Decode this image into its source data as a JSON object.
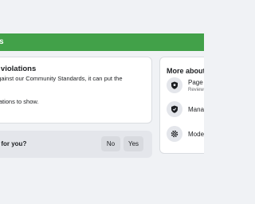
{
  "status_bar": {
    "color": "#42a149"
  },
  "violations": {
    "title": "s violations",
    "description": "against our Community Standards, it can put the",
    "description_line2": "s.",
    "empty_text": "olations to show."
  },
  "feedback": {
    "question": "ul for you?",
    "no_label": "No",
    "yes_label": "Yes"
  },
  "more_about": {
    "title": "More about",
    "items": [
      {
        "label": "Page r",
        "sublabel": "Review",
        "icon": "shield-icon"
      },
      {
        "label": "Manag",
        "sublabel": "",
        "icon": "shield-check-icon"
      },
      {
        "label": "Mode",
        "sublabel": "",
        "icon": "gear-icon"
      }
    ]
  }
}
